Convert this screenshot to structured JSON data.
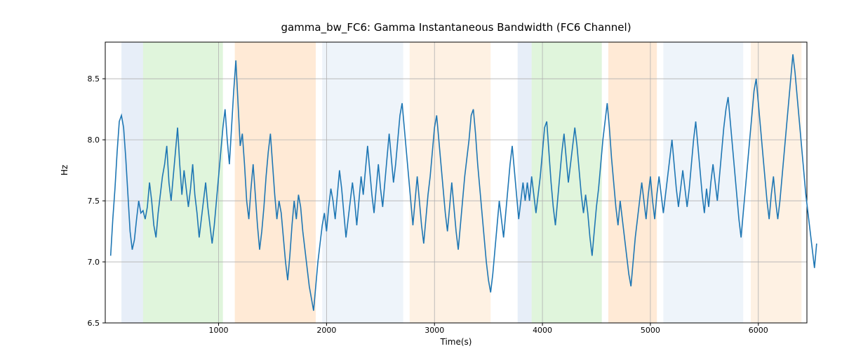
{
  "chart_data": {
    "type": "line",
    "title": "gamma_bw_FC6: Gamma Instantaneous Bandwidth (FC6 Channel)",
    "xlabel": "Time(s)",
    "ylabel": "Hz",
    "xlim": [
      -50,
      6450
    ],
    "ylim": [
      6.5,
      8.8
    ],
    "x_ticks": [
      1000,
      2000,
      3000,
      4000,
      5000,
      6000
    ],
    "y_ticks": [
      6.5,
      7.0,
      7.5,
      8.0,
      8.5
    ],
    "bands": [
      {
        "start": 100,
        "end": 300,
        "color": "#aec7e8"
      },
      {
        "start": 300,
        "end": 1040,
        "color": "#98df8a"
      },
      {
        "start": 1150,
        "end": 1900,
        "color": "#ffbb78"
      },
      {
        "start": 1960,
        "end": 2710,
        "color": "#c6dbef"
      },
      {
        "start": 2770,
        "end": 3520,
        "color": "#fdd0a2"
      },
      {
        "start": 3770,
        "end": 3900,
        "color": "#aec7e8"
      },
      {
        "start": 3900,
        "end": 4550,
        "color": "#98df8a"
      },
      {
        "start": 4610,
        "end": 5060,
        "color": "#ffbb78"
      },
      {
        "start": 5120,
        "end": 5860,
        "color": "#c6dbef"
      },
      {
        "start": 5930,
        "end": 6400,
        "color": "#fdd0a2"
      }
    ],
    "series": [
      {
        "name": "gamma_bw_FC6",
        "color": "#1f77b4",
        "x_step": 20,
        "values": [
          7.05,
          7.35,
          7.6,
          7.9,
          8.15,
          8.2,
          8.1,
          7.85,
          7.55,
          7.25,
          7.1,
          7.18,
          7.35,
          7.5,
          7.4,
          7.42,
          7.35,
          7.45,
          7.65,
          7.5,
          7.3,
          7.2,
          7.4,
          7.55,
          7.7,
          7.8,
          7.95,
          7.65,
          7.5,
          7.7,
          7.9,
          8.1,
          7.8,
          7.55,
          7.75,
          7.6,
          7.45,
          7.6,
          7.8,
          7.55,
          7.4,
          7.2,
          7.35,
          7.5,
          7.65,
          7.45,
          7.3,
          7.15,
          7.3,
          7.5,
          7.7,
          7.9,
          8.1,
          8.25,
          8.0,
          7.8,
          8.1,
          8.4,
          8.65,
          8.3,
          7.95,
          8.05,
          7.8,
          7.5,
          7.35,
          7.6,
          7.8,
          7.55,
          7.3,
          7.1,
          7.25,
          7.45,
          7.7,
          7.9,
          8.05,
          7.8,
          7.55,
          7.35,
          7.5,
          7.4,
          7.2,
          7.0,
          6.85,
          7.05,
          7.3,
          7.5,
          7.35,
          7.55,
          7.45,
          7.25,
          7.1,
          6.95,
          6.8,
          6.7,
          6.6,
          6.8,
          7.0,
          7.15,
          7.3,
          7.4,
          7.25,
          7.45,
          7.6,
          7.5,
          7.35,
          7.55,
          7.75,
          7.6,
          7.4,
          7.2,
          7.35,
          7.5,
          7.65,
          7.5,
          7.3,
          7.5,
          7.7,
          7.55,
          7.75,
          7.95,
          7.75,
          7.55,
          7.4,
          7.6,
          7.8,
          7.6,
          7.45,
          7.65,
          7.85,
          8.05,
          7.85,
          7.65,
          7.8,
          8.0,
          8.2,
          8.3,
          8.1,
          7.9,
          7.7,
          7.5,
          7.3,
          7.5,
          7.7,
          7.5,
          7.3,
          7.15,
          7.35,
          7.55,
          7.7,
          7.9,
          8.1,
          8.2,
          8.0,
          7.8,
          7.6,
          7.4,
          7.25,
          7.45,
          7.65,
          7.45,
          7.25,
          7.1,
          7.3,
          7.5,
          7.7,
          7.85,
          8.0,
          8.2,
          8.25,
          8.05,
          7.8,
          7.6,
          7.4,
          7.2,
          7.0,
          6.85,
          6.75,
          6.9,
          7.1,
          7.3,
          7.5,
          7.35,
          7.2,
          7.4,
          7.6,
          7.8,
          7.95,
          7.75,
          7.55,
          7.35,
          7.5,
          7.65,
          7.5,
          7.65,
          7.5,
          7.7,
          7.55,
          7.4,
          7.55,
          7.7,
          7.9,
          8.1,
          8.15,
          7.9,
          7.65,
          7.45,
          7.3,
          7.5,
          7.7,
          7.9,
          8.05,
          7.85,
          7.65,
          7.8,
          7.95,
          8.1,
          7.95,
          7.75,
          7.55,
          7.4,
          7.55,
          7.4,
          7.2,
          7.05,
          7.25,
          7.45,
          7.6,
          7.8,
          8.0,
          8.15,
          8.3,
          8.1,
          7.85,
          7.65,
          7.45,
          7.3,
          7.5,
          7.35,
          7.2,
          7.05,
          6.9,
          6.8,
          7.0,
          7.2,
          7.35,
          7.5,
          7.65,
          7.5,
          7.35,
          7.55,
          7.7,
          7.5,
          7.35,
          7.55,
          7.7,
          7.55,
          7.4,
          7.55,
          7.7,
          7.85,
          8.0,
          7.8,
          7.6,
          7.45,
          7.6,
          7.75,
          7.6,
          7.45,
          7.6,
          7.8,
          8.0,
          8.15,
          7.95,
          7.75,
          7.55,
          7.4,
          7.6,
          7.45,
          7.65,
          7.8,
          7.65,
          7.5,
          7.7,
          7.9,
          8.1,
          8.25,
          8.35,
          8.15,
          7.95,
          7.75,
          7.55,
          7.35,
          7.2,
          7.4,
          7.6,
          7.8,
          8.0,
          8.2,
          8.4,
          8.5,
          8.3,
          8.1,
          7.9,
          7.7,
          7.5,
          7.35,
          7.55,
          7.7,
          7.5,
          7.35,
          7.5,
          7.7,
          7.9,
          8.1,
          8.3,
          8.5,
          8.7,
          8.55,
          8.35,
          8.15,
          7.95,
          7.75,
          7.55,
          7.4,
          7.25,
          7.1,
          6.95,
          7.15
        ]
      }
    ]
  }
}
